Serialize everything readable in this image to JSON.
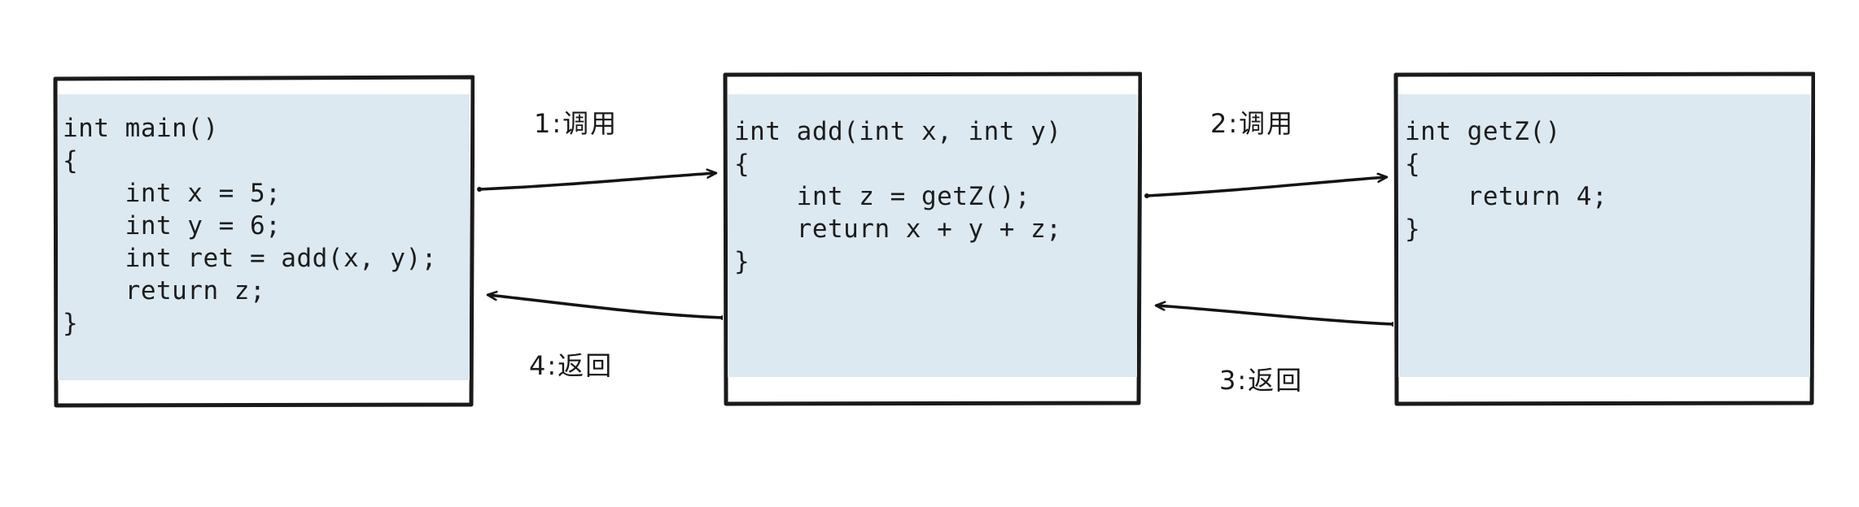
{
  "diagram": {
    "title": "Function call and return sequence diagram",
    "type": "call-return-sequence",
    "background_color": "#ffffff",
    "box_border_color": "#1a1a1a",
    "code_band_color": "#dce9f1",
    "text_color": "#1c1c1c"
  },
  "boxes": [
    {
      "id": "main",
      "name": "main-function-box",
      "code": "int main()\n{\n    int x = 5;\n    int y = 6;\n    int ret = add(x, y);\n    return z;\n}"
    },
    {
      "id": "add",
      "name": "add-function-box",
      "code": "int add(int x, int y)\n{\n    int z = getZ();\n    return x + y + z;\n}"
    },
    {
      "id": "getz",
      "name": "getz-function-box",
      "code": "int getZ()\n{\n    return 4;\n}"
    }
  ],
  "edges": [
    {
      "id": "call1",
      "label": "1:调用",
      "from": "main",
      "to": "add",
      "direction": "right"
    },
    {
      "id": "call2",
      "label": "2:调用",
      "from": "add",
      "to": "getz",
      "direction": "right"
    },
    {
      "id": "return3",
      "label": "3:返回",
      "from": "getz",
      "to": "add",
      "direction": "left"
    },
    {
      "id": "return4",
      "label": "4:返回",
      "from": "add",
      "to": "main",
      "direction": "left"
    }
  ]
}
